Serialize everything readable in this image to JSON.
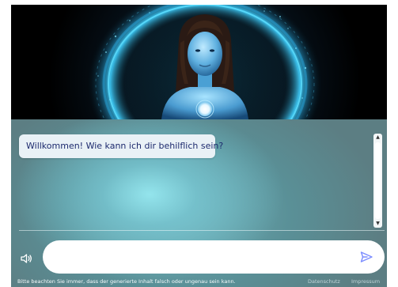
{
  "chat": {
    "messages": [
      {
        "role": "assistant",
        "text": "Willkommen! Wie kann ich dir behilflich sein?"
      }
    ],
    "input_value": "",
    "input_placeholder": ""
  },
  "footer": {
    "disclaimer": "Bitte beachten Sie immer, dass der generierte Inhalt falsch oder ungenau sein kann.",
    "links": [
      "Datenschutz",
      "Impressum"
    ]
  },
  "icons": {
    "speaker": "speaker-icon",
    "send": "send-icon",
    "scroll_up": "chevron-up-icon",
    "scroll_down": "chevron-down-icon"
  },
  "colors": {
    "accent": "#7b8cff",
    "message_text": "#1d2a6e",
    "glow": "#3fd0ff"
  }
}
